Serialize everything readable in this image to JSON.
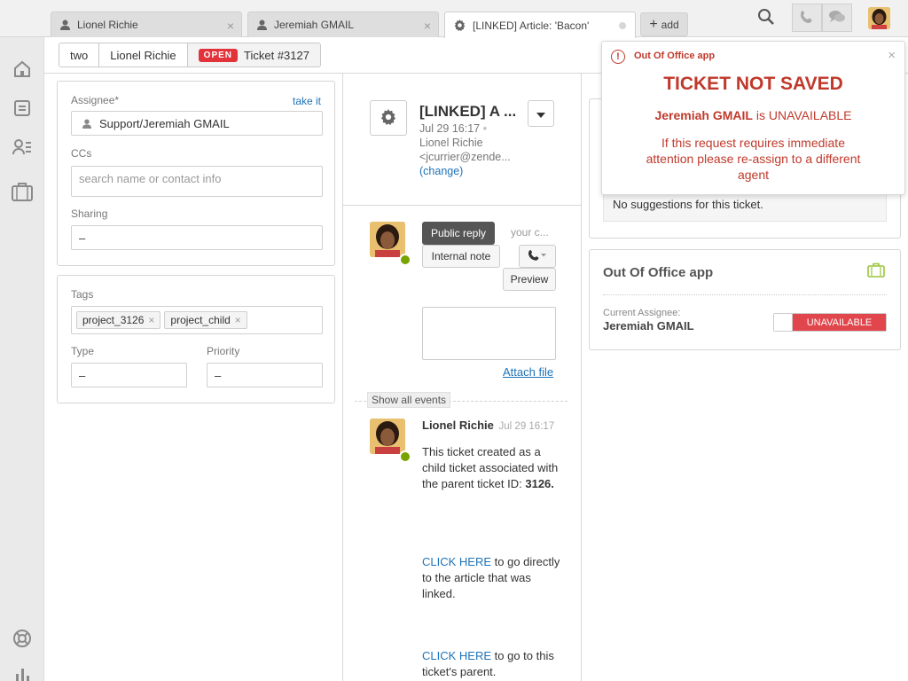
{
  "tabs": [
    {
      "label": "Lionel Richie",
      "icon": "user-icon"
    },
    {
      "label": "Jeremiah GMAIL",
      "icon": "user-icon"
    },
    {
      "label": "[LINKED] Article: 'Bacon'",
      "icon": "gear-icon"
    }
  ],
  "add_tab_label": "add",
  "breadcrumbs": {
    "org": "two",
    "requester": "Lionel Richie",
    "status": "OPEN",
    "ticket": "Ticket #3127"
  },
  "properties": {
    "assignee_label": "Assignee*",
    "take_it": "take it",
    "assignee_value": "Support/Jeremiah GMAIL",
    "ccs_label": "CCs",
    "ccs_placeholder": "search name or contact info",
    "sharing_label": "Sharing",
    "sharing_value": "–",
    "tags_label": "Tags",
    "tags": [
      "project_3126",
      "project_child"
    ],
    "type_label": "Type",
    "type_value": "–",
    "priority_label": "Priority",
    "priority_value": "–"
  },
  "ticket": {
    "title": "[LINKED] A ...",
    "date": "Jul 29 16:17",
    "requester": "Lionel Richie",
    "email": "<jcurrier@zende...",
    "change": "(change)"
  },
  "composer": {
    "public_reply": "Public reply",
    "your_comment": "your c...",
    "internal_note": "Internal note",
    "preview": "Preview",
    "attach_file": "Attach file",
    "show_all_events": "Show all events"
  },
  "comment": {
    "author": "Lionel Richie",
    "time": "Jul 29 16:17",
    "line1": "This ticket created as a child ticket associated with the parent ticket ID:",
    "parent_id": "3126.",
    "link1": "CLICK HERE",
    "text1": " to go directly to the article that was linked.",
    "link2": "CLICK HERE",
    "text2": " to go to this ticket's parent."
  },
  "apps": {
    "suggestions": "No suggestions for this ticket.",
    "ooo_title": "Out Of Office app",
    "current_assignee_label": "Current Assignee:",
    "current_assignee": "Jeremiah GMAIL",
    "status": "UNAVAILABLE"
  },
  "notification": {
    "app": "Out Of Office app",
    "title": "TICKET NOT SAVED",
    "agent": "Jeremiah GMAIL",
    "is": " is ",
    "state": "UNAVAILABLE",
    "body": "If this request requires immediate attention please re-assign to a different agent"
  },
  "colors": {
    "open_badge": "#e2323a",
    "link": "#1f73b7",
    "alert": "#c0392b",
    "unavailable": "#e0464b",
    "online": "#78a300"
  }
}
